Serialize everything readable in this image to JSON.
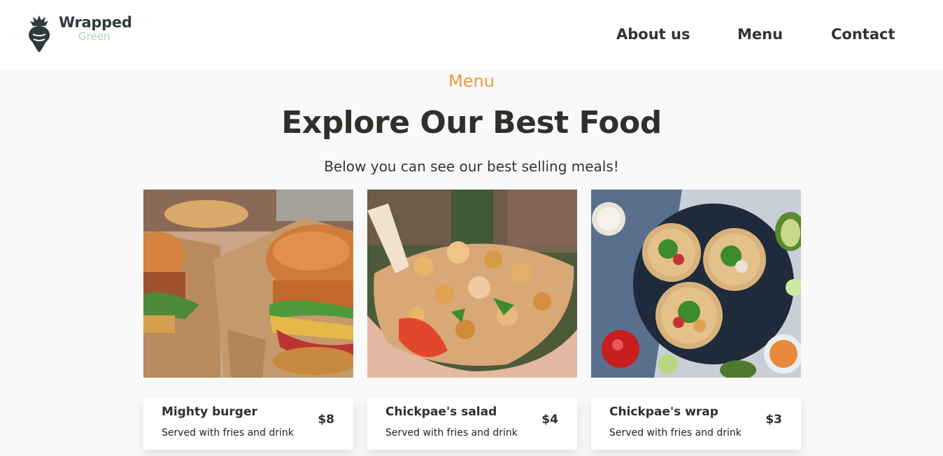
{
  "header": {
    "logo": {
      "word1": "Wrapped",
      "word2": "Green",
      "icon": "turnip-icon"
    },
    "nav": [
      {
        "label": "About us"
      },
      {
        "label": "Menu"
      },
      {
        "label": "Contact"
      }
    ]
  },
  "section": {
    "eyebrow": "Menu",
    "title": "Explore Our Best Food",
    "subtitle": "Below you can see our best selling meals!"
  },
  "cards": [
    {
      "name": "Mighty burger",
      "description": "Served with fries and drink",
      "price": "$8",
      "image": "burger-photo"
    },
    {
      "name": "Chickpae's salad",
      "description": "Served with fries and drink",
      "price": "$4",
      "image": "salad-photo"
    },
    {
      "name": "Chickpae's wrap",
      "description": "Served with fries and drink",
      "price": "$3",
      "image": "tacos-photo"
    }
  ],
  "colors": {
    "accent": "#ee9a3a",
    "text": "#2f302c",
    "logo_dark": "#2e3a3c",
    "logo_green": "#a8d8b0",
    "background": "#f9f9f9"
  }
}
